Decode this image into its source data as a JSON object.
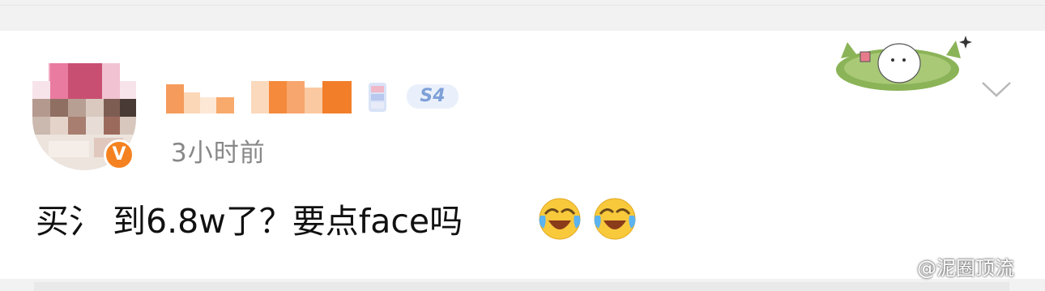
{
  "post": {
    "author_name": "",
    "level_badge": "S4",
    "time": "3小时前",
    "text": "买氵 到6.8w了？要点face吗",
    "emojis": [
      "laughing-crying-emoji",
      "laughing-crying-emoji"
    ]
  },
  "watermark": {
    "text": "@泥圈顶流"
  },
  "icons": {
    "verified": "verified-v-icon",
    "more": "chevron-down-icon",
    "sticker": "sleeping-cat-sticker",
    "weibo": "weibo-logo-icon"
  },
  "colors": {
    "verified_badge": "#f58220",
    "time_text": "#888888",
    "level_badge_text": "#7ea0d8",
    "background_band": "#f2f2f2"
  }
}
